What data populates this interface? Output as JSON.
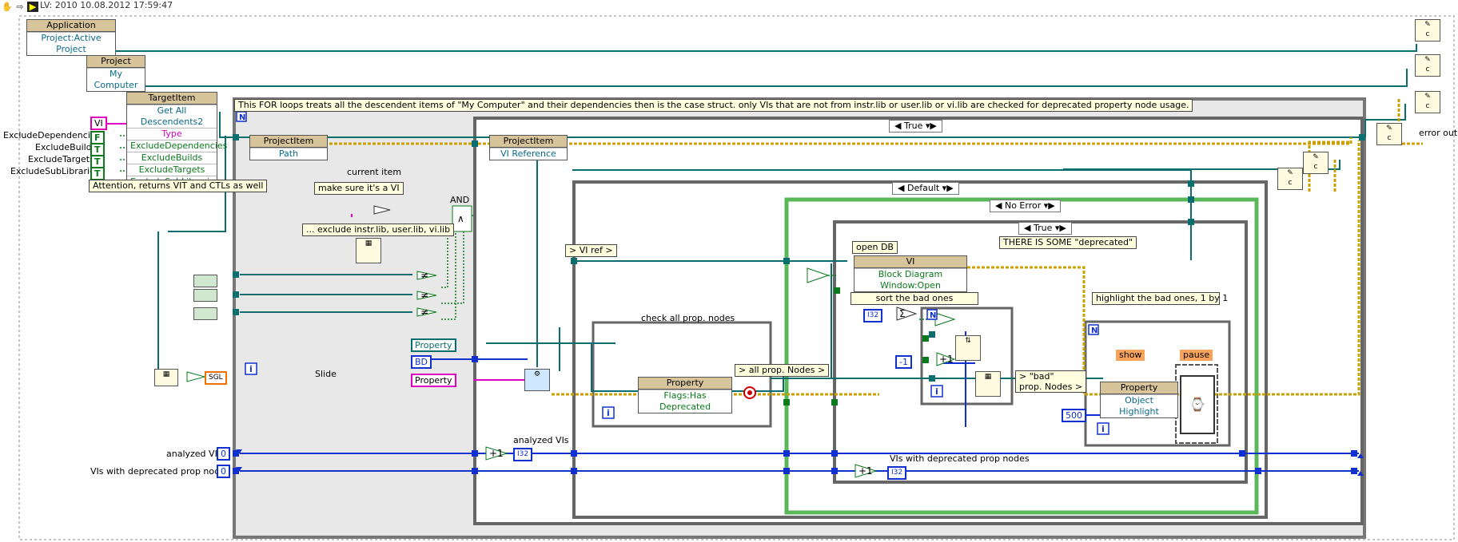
{
  "window": {
    "title": "LV: 2010 10.08.2012 17:59:47"
  },
  "toolbar": {
    "icons": [
      "hand-icon",
      "arrow-icon",
      "labview-icon"
    ]
  },
  "nodes": {
    "application": {
      "header": "Application",
      "property": "Project:Active Project"
    },
    "project": {
      "header": "Project",
      "property": "My Computer"
    },
    "target_item": {
      "header": "TargetItem",
      "method": "Get All Descendents2",
      "params": [
        "Type",
        "ExcludeDependencies",
        "ExcludeBuilds",
        "ExcludeTargets",
        "ExcludeSubLibraries"
      ]
    },
    "project_item_path": {
      "header": "ProjectItem",
      "property": "Path"
    },
    "project_item_vi": {
      "header": "ProjectItem",
      "property": "VI Reference"
    },
    "vi_open": {
      "header": "VI",
      "property": "Block Diagram Window:Open"
    },
    "property_has_deprecated": {
      "header": "Property",
      "property": "Flags:Has Deprecated"
    },
    "property_object_highlight": {
      "header": "Property",
      "property": "Object Highlight"
    }
  },
  "inputs": {
    "exclude_labels": [
      "ExcludeDependencies",
      "ExcludeBuilds",
      "ExcludeTargets",
      "ExcludeSubLibraries"
    ],
    "vi_const": "VI",
    "analyzed_vis_label": "analyzed VIs",
    "analyzed_vis_value": "0",
    "deprecated_label": "VIs with deprecated prop nodes",
    "deprecated_value": "0",
    "property_class": "Property",
    "bd": "BD",
    "property_str": "Property",
    "num_500": "500",
    "num_minus1": "-1",
    "sgl": "SGL",
    "i32": "I32",
    "slide_label": "Slide",
    "error_out_label": "error out"
  },
  "comments": {
    "for_loop": "This FOR loops treats all the descendent items of \"My Computer\" and their dependencies then is the case struct. only VIs that are not from instr.lib or user.lib or vi.lib are checked for deprecated property node usage.",
    "attention": "Attention, returns VIT and CTLs as well",
    "make_sure": "make sure it's a VI",
    "exclude": "... exclude instr.lib, user.lib, vi.lib",
    "check_all": "check all prop. nodes",
    "sort_bad": "sort the bad ones",
    "highlight": "highlight the bad ones, 1 by 1",
    "there_is": "THERE IS SOME \"deprecated\"",
    "open_db": "open DB"
  },
  "labels": {
    "current_item": "current item",
    "and_label": "AND",
    "vi_ref": "> VI ref >",
    "all_prop_nodes": "> all prop. Nodes >",
    "bad_prop_nodes_1": "> \"bad\"",
    "bad_prop_nodes_2": "prop. Nodes >",
    "analyzed_vis_ind": "analyzed VIs",
    "vis_dep_ind": "VIs with deprecated prop nodes",
    "show": "show",
    "pause": "pause",
    "iter": "i",
    "loop_n": "N"
  },
  "cases": {
    "outer": "True",
    "default": "Default",
    "no_error": "No Error",
    "inner_true": "True"
  },
  "colors": {
    "refnum_wire": "#0b6e6e",
    "int_wire": "#1030d0",
    "bool_wire": "#0b7a1c",
    "error_wire": "#c8a000",
    "string_wire": "#e000c0",
    "struct_gray": "#7a7a7a",
    "struct_green": "#5ab85a"
  }
}
